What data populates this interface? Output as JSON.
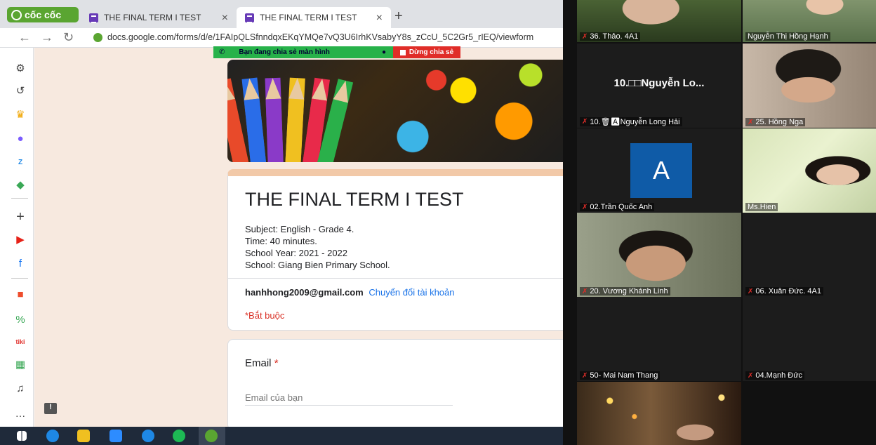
{
  "browser": {
    "brand": "cốc cốc",
    "tabs": [
      {
        "label": "THE FINAL TERM I TEST"
      },
      {
        "label": "THE FINAL TERM I TEST"
      }
    ],
    "url": "docs.google.com/forms/d/e/1FAIpQLSfnndqxEKqYMQe7vQ3U6IrhKVsabyY8s_zCcU_5C2Gr5_rIEQ/viewform",
    "screen_share": {
      "status_text": "Bạn đang chia sẻ màn hình",
      "stop_label": "Dừng chia sẻ"
    }
  },
  "form": {
    "title": "THE FINAL TERM I TEST",
    "description": [
      "Subject: English - Grade 4.",
      "Time: 40 minutes.",
      "School Year: 2021 - 2022",
      "School: Giang Bien Primary School."
    ],
    "account_email": "hanhhong2009@gmail.com",
    "switch_account": "Chuyển đổi tài khoản",
    "required_note": "*Bắt buộc",
    "question": {
      "label": "Email",
      "required_mark": "*",
      "placeholder": "Email của bạn"
    }
  },
  "participants": [
    {
      "name": "36. Thảo. 4A1",
      "muted": true
    },
    {
      "name": "Nguyễn Thị Hồng Hạnh",
      "muted": false
    },
    {
      "name": "10.🗑🅰Nguyễn Long Hải",
      "muted": true,
      "display_name": "10.□□Nguyễn Lo..."
    },
    {
      "name": "25. Hồng Nga",
      "muted": true
    },
    {
      "name": "02.Trần Quốc Anh",
      "muted": true,
      "avatar_letter": "A"
    },
    {
      "name": "Ms.Hien",
      "muted": false
    },
    {
      "name": "20. Vương Khánh Linh",
      "muted": true
    },
    {
      "name": "06. Xuân Đức. 4A1",
      "muted": true
    },
    {
      "name": "50- Mai Nam Thang",
      "muted": true
    },
    {
      "name": "04.Mạnh Đức",
      "muted": true
    }
  ],
  "colors": {
    "brand_green": "#5aa531",
    "forms_purple": "#673ab7",
    "share_green": "#27b24a",
    "stop_red": "#e02d28",
    "link_blue": "#1a73e8",
    "active_speaker": "#c7e35a",
    "avatar_blue": "#0f5ba7"
  }
}
